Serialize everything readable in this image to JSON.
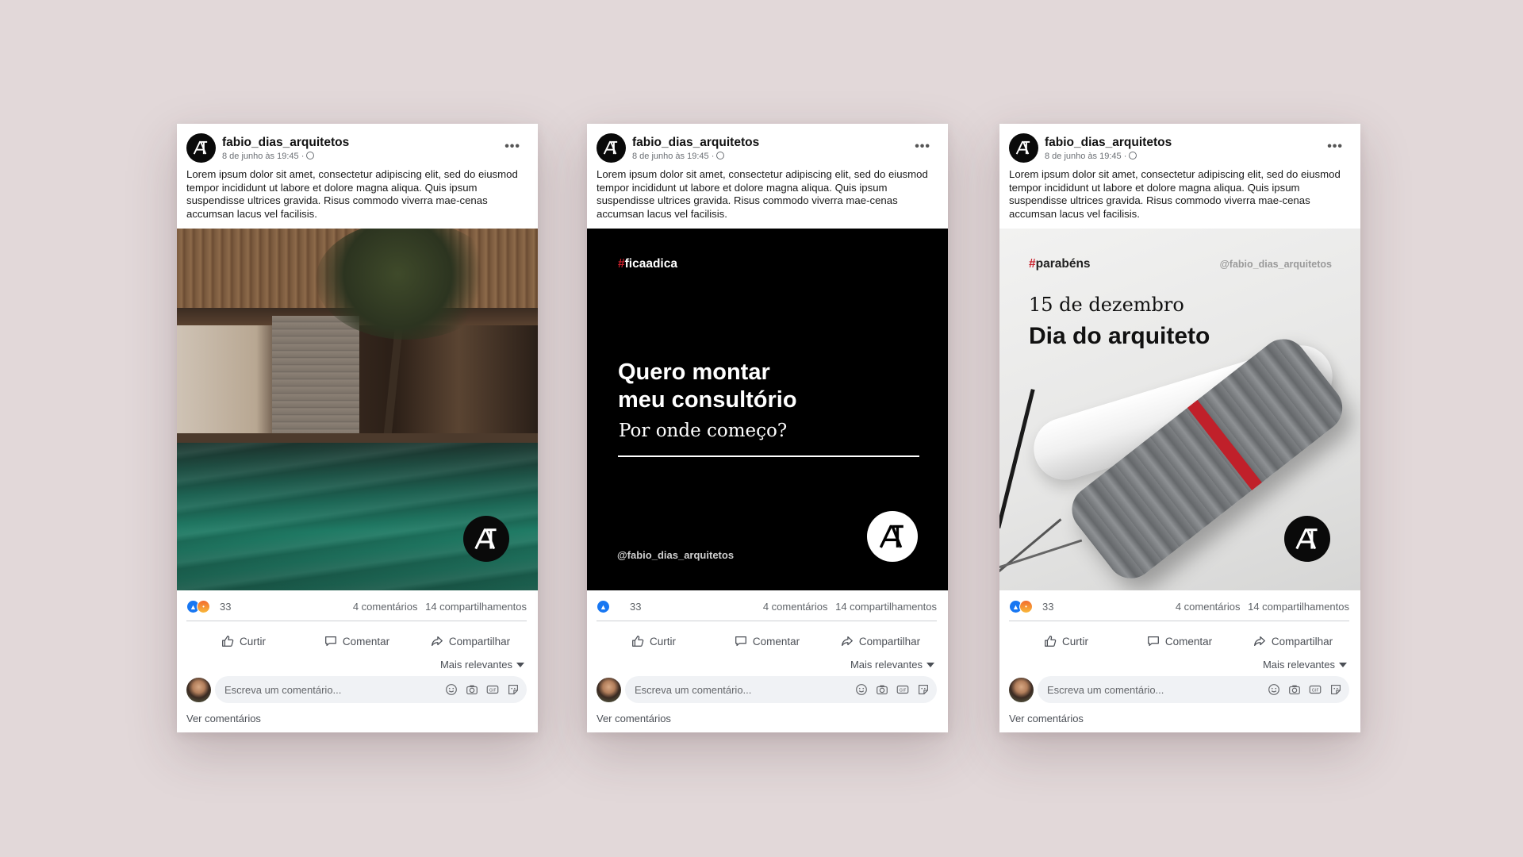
{
  "posts": [
    {
      "author": "fabio_dias_arquitetos",
      "timestamp": "8 de junho às 19:45 ·",
      "caption": "Lorem ipsum dolor sit amet, consectetur adipiscing elit, sed do eiusmod tempor incididunt ut labore et dolore magna aliqua. Quis ipsum suspendisse ultrices gravida. Risus commodo viverra mae-cenas accumsan lacus vel facilisis.",
      "reaction_count": "33",
      "comments": "4 comentários",
      "shares": "14 compartilhamentos",
      "actions": {
        "like": "Curtir",
        "comment": "Comentar",
        "share": "Compartilhar"
      },
      "sort_label": "Mais relevantes",
      "comment_placeholder": "Escreva um comentário...",
      "view_comments": "Ver comentários"
    },
    {
      "author": "fabio_dias_arquitetos",
      "timestamp": "8 de junho às 19:45 ·",
      "caption": "Lorem ipsum dolor sit amet, consectetur adipiscing elit, sed do eiusmod tempor incididunt ut labore et dolore magna aliqua. Quis ipsum suspendisse ultrices gravida. Risus commodo viverra mae-cenas accumsan lacus vel facilisis.",
      "media": {
        "hash": "#",
        "tag": "ficaadica",
        "headline_line1": "Quero montar",
        "headline_line2": "meu consultório",
        "subheadline": "Por onde começo?",
        "handle": "@fabio_dias_arquitetos"
      },
      "reaction_count": "33",
      "comments": "4 comentários",
      "shares": "14 compartilhamentos",
      "actions": {
        "like": "Curtir",
        "comment": "Comentar",
        "share": "Compartilhar"
      },
      "sort_label": "Mais relevantes",
      "comment_placeholder": "Escreva um comentário...",
      "view_comments": "Ver comentários"
    },
    {
      "author": "fabio_dias_arquitetos",
      "timestamp": "8 de junho às 19:45 ·",
      "caption": "Lorem ipsum dolor sit amet, consectetur adipiscing elit, sed do eiusmod tempor incididunt ut labore et dolore magna aliqua. Quis ipsum suspendisse ultrices gravida. Risus commodo viverra mae-cenas accumsan lacus vel facilisis.",
      "media": {
        "hash": "#",
        "tag": "parabéns",
        "handle": "@fabio_dias_arquitetos",
        "date": "15 de dezembro",
        "title": "Dia do arquiteto"
      },
      "reaction_count": "33",
      "comments": "4 comentários",
      "shares": "14 compartilhamentos",
      "actions": {
        "like": "Curtir",
        "comment": "Comentar",
        "share": "Compartilhar"
      },
      "sort_label": "Mais relevantes",
      "comment_placeholder": "Escreva um comentário...",
      "view_comments": "Ver comentários"
    }
  ],
  "colors": {
    "background": "#e2d8d9",
    "like_blue": "#1877f2",
    "accent_red": "#d11f2b",
    "text_muted": "#65676b"
  },
  "icons": [
    "brand-logo-icon",
    "more-dots-icon",
    "globe-icon",
    "like-reaction-icon",
    "angry-reaction-icon",
    "thumbs-up-icon",
    "comment-bubble-icon",
    "share-arrow-icon",
    "caret-down-icon",
    "emoji-icon",
    "camera-icon",
    "gif-icon",
    "sticker-icon"
  ]
}
